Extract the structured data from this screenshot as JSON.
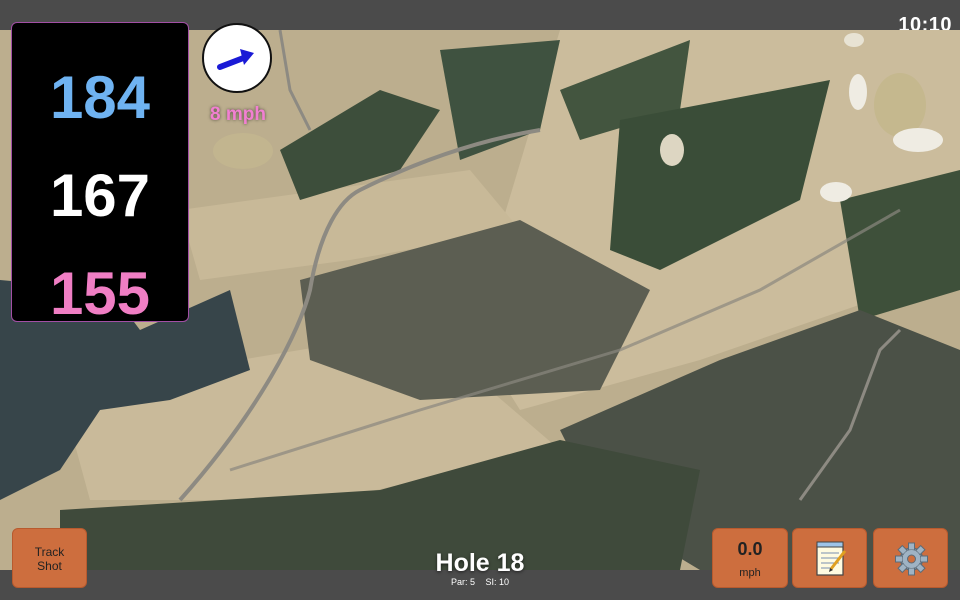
{
  "status": {
    "time": "10:10"
  },
  "yardages": {
    "back": "184",
    "middle": "167",
    "front": "155"
  },
  "wind": {
    "speed_label": "8 mph",
    "arrow_color": "#1a1ad6"
  },
  "buttons": {
    "track_shot_line1": "Track",
    "track_shot_line2": "Shot",
    "speed_value": "0.0",
    "speed_unit": "mph",
    "notes_icon": "notepad-icon",
    "settings_icon": "gear-icon"
  },
  "hole": {
    "title": "Hole 18",
    "par": "Par: 5",
    "si": "SI: 10"
  },
  "colors": {
    "accent_button": "#cd6e3e",
    "back_yardage": "#6fb3f2",
    "front_yardage": "#f07ec4",
    "wind_text": "#f27fd2"
  }
}
